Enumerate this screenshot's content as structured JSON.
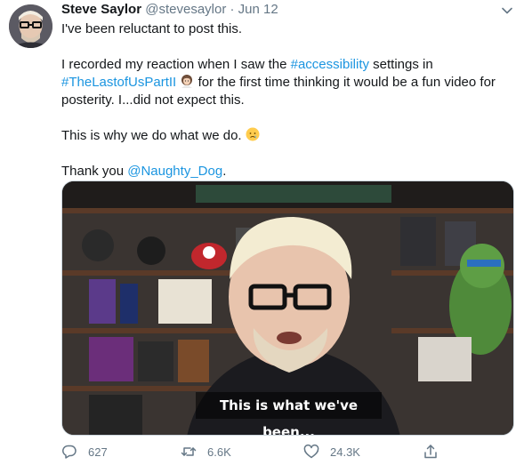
{
  "tweet": {
    "author_name": "Steve Saylor",
    "handle": "@stevesaylor",
    "separator": "·",
    "date": "Jun 12",
    "line1": "I've been reluctant to post this.",
    "p2_pre": "I recorded my reaction when I saw the ",
    "p2_hashtag1": "#accessibility",
    "p2_mid": " settings in ",
    "p2_hashtag2": "#TheLastofUsPartII",
    "p2_post": " for the first time thinking it would be a fun video for posterity. I...did not expect this.",
    "p3": "This is why we do what we do.",
    "p4_pre": "Thank you ",
    "p4_mention": "@Naughty_Dog",
    "p4_post": ".",
    "video_caption": "This is what we've been...",
    "actions": {
      "replies": "627",
      "retweets": "6.6K",
      "likes": "24.3K"
    }
  },
  "colors": {
    "link": "#1b95e0",
    "muted": "#657786",
    "text": "#14171a"
  },
  "icons": [
    "caret-down-icon",
    "woman-emoji-icon",
    "crying-face-emoji-icon",
    "reply-icon",
    "retweet-icon",
    "like-icon",
    "share-icon"
  ]
}
